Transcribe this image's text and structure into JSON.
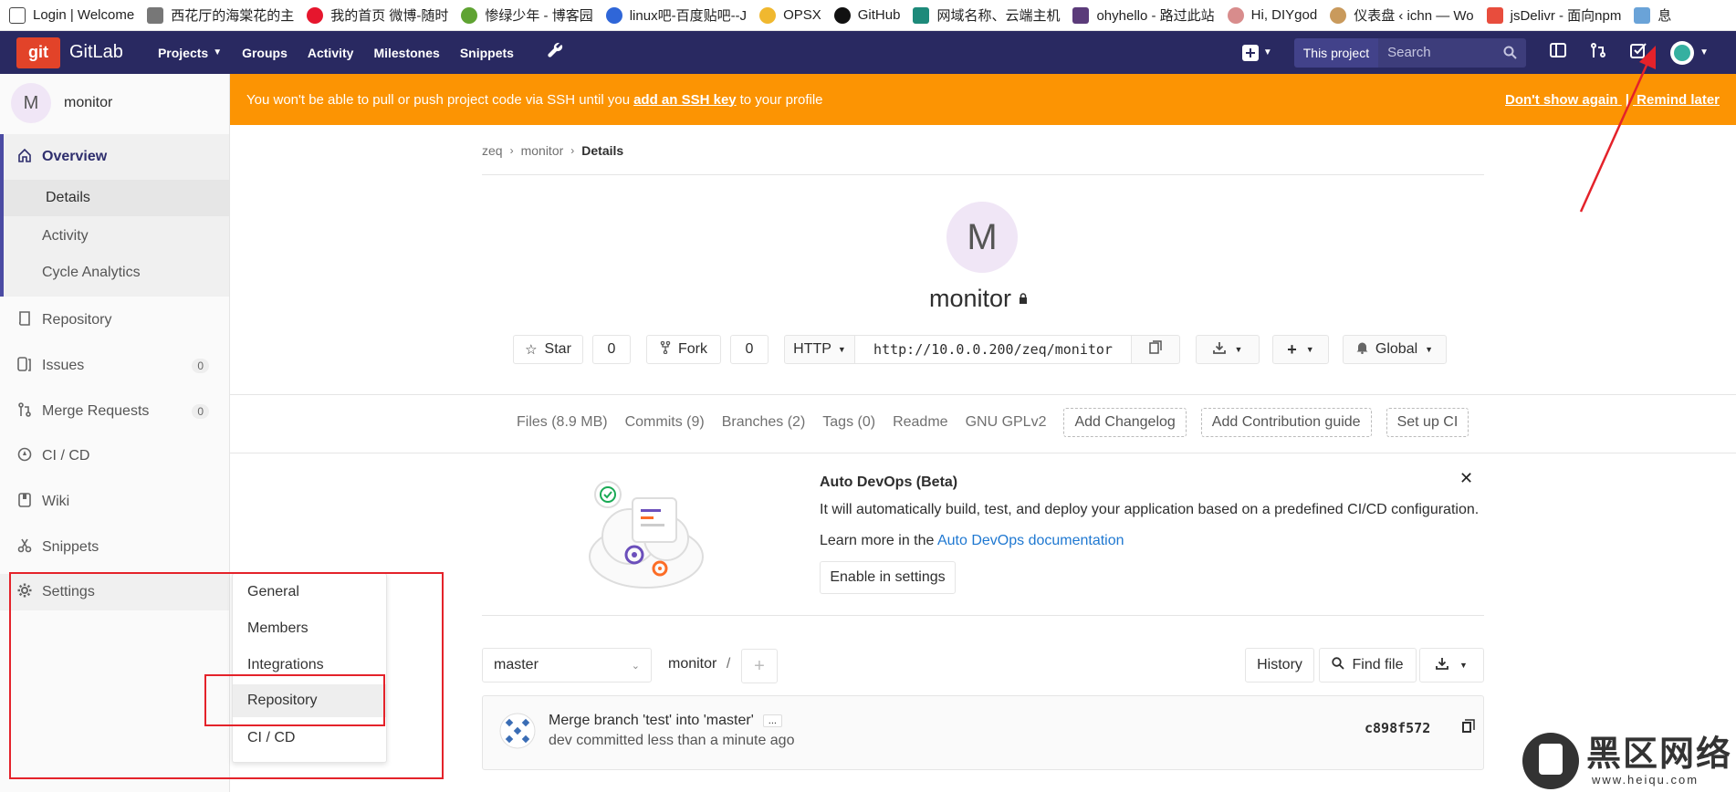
{
  "bookmarks": [
    {
      "label": "Login | Welcome",
      "color": "#444444"
    },
    {
      "label": "西花厅的海棠花的主",
      "color": "#777777"
    },
    {
      "label": "我的首页 微博-随时",
      "color": "#e6162d"
    },
    {
      "label": "惨绿少年 - 博客园",
      "color": "#5fa332"
    },
    {
      "label": "linux吧-百度贴吧--J",
      "color": "#2f66d8"
    },
    {
      "label": "OPSX",
      "color": "#f0b82f"
    },
    {
      "label": "GitHub",
      "color": "#111111"
    },
    {
      "label": "网域名称、云端主机",
      "color": "#1d8a7a"
    },
    {
      "label": "ohyhello - 路过此站",
      "color": "#5b3b7a"
    },
    {
      "label": "Hi, DIYgod",
      "color": "#d88c8c"
    },
    {
      "label": "仪表盘 ‹ ichn — Wo",
      "color": "#c99a5c"
    },
    {
      "label": "jsDelivr - 面向npm",
      "color": "#e84d3d"
    },
    {
      "label": "息",
      "color": "#6aa3d8"
    }
  ],
  "topnav": {
    "logo_text": "git",
    "brand": "GitLab",
    "links": [
      "Projects",
      "Groups",
      "Activity",
      "Milestones",
      "Snippets"
    ],
    "search_scope": "This project",
    "search_placeholder": "Search"
  },
  "sidebar": {
    "project_initial": "M",
    "project_name": "monitor",
    "overview": "Overview",
    "overview_sub": [
      "Details",
      "Activity",
      "Cycle Analytics"
    ],
    "repository": "Repository",
    "issues": "Issues",
    "issues_count": "0",
    "merge_requests": "Merge Requests",
    "mr_count": "0",
    "cicd": "CI / CD",
    "wiki": "Wiki",
    "snippets": "Snippets",
    "settings": "Settings"
  },
  "flyout": [
    "General",
    "Members",
    "Integrations",
    "Repository",
    "CI / CD"
  ],
  "alert": {
    "text_before": "You won't be able to pull or push project code via SSH until you ",
    "link": "add an SSH key",
    "text_after": " to your profile",
    "dont_show": "Don't show again",
    "separator": "|",
    "remind": "Remind later"
  },
  "breadcrumb": [
    "zeq",
    "monitor",
    "Details"
  ],
  "project": {
    "initial": "M",
    "name": "monitor"
  },
  "actions": {
    "star": "Star",
    "star_count": "0",
    "fork": "Fork",
    "fork_count": "0",
    "protocol": "HTTP",
    "clone_url": "http://10.0.0.200/zeq/monitor",
    "notification": "Global"
  },
  "stats": {
    "files": "Files (8.9 MB)",
    "commits": "Commits (9)",
    "branches": "Branches (2)",
    "tags": "Tags (0)",
    "readme": "Readme",
    "license": "GNU GPLv2",
    "add_changelog": "Add Changelog",
    "add_contrib": "Add Contribution guide",
    "setup_ci": "Set up CI"
  },
  "devops": {
    "title": "Auto DevOps (Beta)",
    "description": "It will automatically build, test, and deploy your application based on a predefined CI/CD configuration.",
    "learn_prefix": "Learn more in the ",
    "learn_link": "Auto DevOps documentation",
    "enable": "Enable in settings"
  },
  "tree": {
    "branch": "master",
    "path": "monitor",
    "path_sep": "/",
    "history": "History",
    "find_file": "Find file"
  },
  "commit": {
    "title": "Merge branch 'test' into 'master'",
    "more": "...",
    "meta": "dev committed less than a minute ago",
    "sha": "c898f572"
  },
  "watermark": {
    "cn": "黑区网络",
    "url": "www.heiqu.com"
  }
}
